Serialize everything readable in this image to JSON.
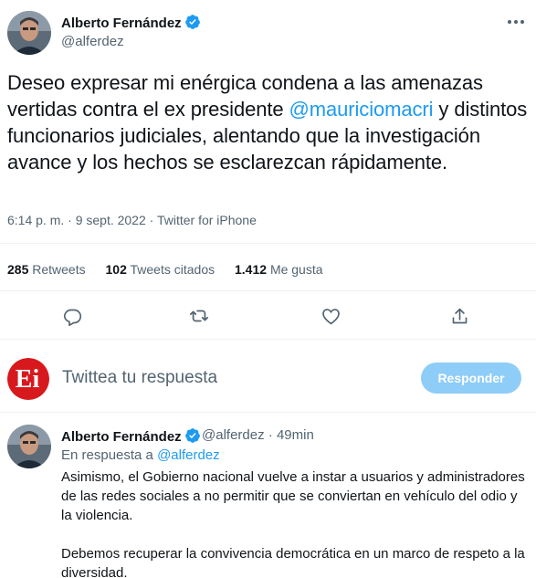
{
  "tweet": {
    "author_name": "Alberto Fernández",
    "author_handle": "@alferdez",
    "text_before_mention": "Deseo expresar mi enérgica condena a las amenazas vertidas contra el ex presidente ",
    "mention": "@mauriciomacri",
    "text_after_mention": " y distintos funcionarios judiciales, alentando que la investigación avance y los hechos se esclarezcan rápidamente.",
    "timestamp": "6:14 p. m. · 9 sept. 2022 · Twitter for iPhone"
  },
  "stats": {
    "retweets_count": "285",
    "retweets_label": "Retweets",
    "quotes_count": "102",
    "quotes_label": "Tweets citados",
    "likes_count": "1.412",
    "likes_label": "Me gusta"
  },
  "reply_box": {
    "avatar_text": "Ei",
    "placeholder": "Twittea tu respuesta",
    "button_label": "Responder"
  },
  "reply": {
    "author_name": "Alberto Fernández",
    "author_handle": "@alferdez",
    "separator": "·",
    "time": "49min",
    "replying_to_label": "En respuesta a",
    "replying_to_handle": "@alferdez",
    "paragraph_1": "Asimismo, el Gobierno nacional vuelve a instar a usuarios y administradores de las redes sociales a no permitir que se conviertan en vehículo del odio y la violencia.",
    "paragraph_2": "Debemos recuperar la convivencia democrática en un marco de respeto a la diversidad."
  },
  "icons": [
    "more-icon",
    "verified-icon",
    "reply-icon",
    "retweet-icon",
    "like-icon",
    "share-icon"
  ],
  "colors": {
    "accent": "#1d9bf0",
    "secondary_text": "#536471",
    "button_disabled": "#8ecdf7",
    "logo_red": "#d7191e"
  }
}
